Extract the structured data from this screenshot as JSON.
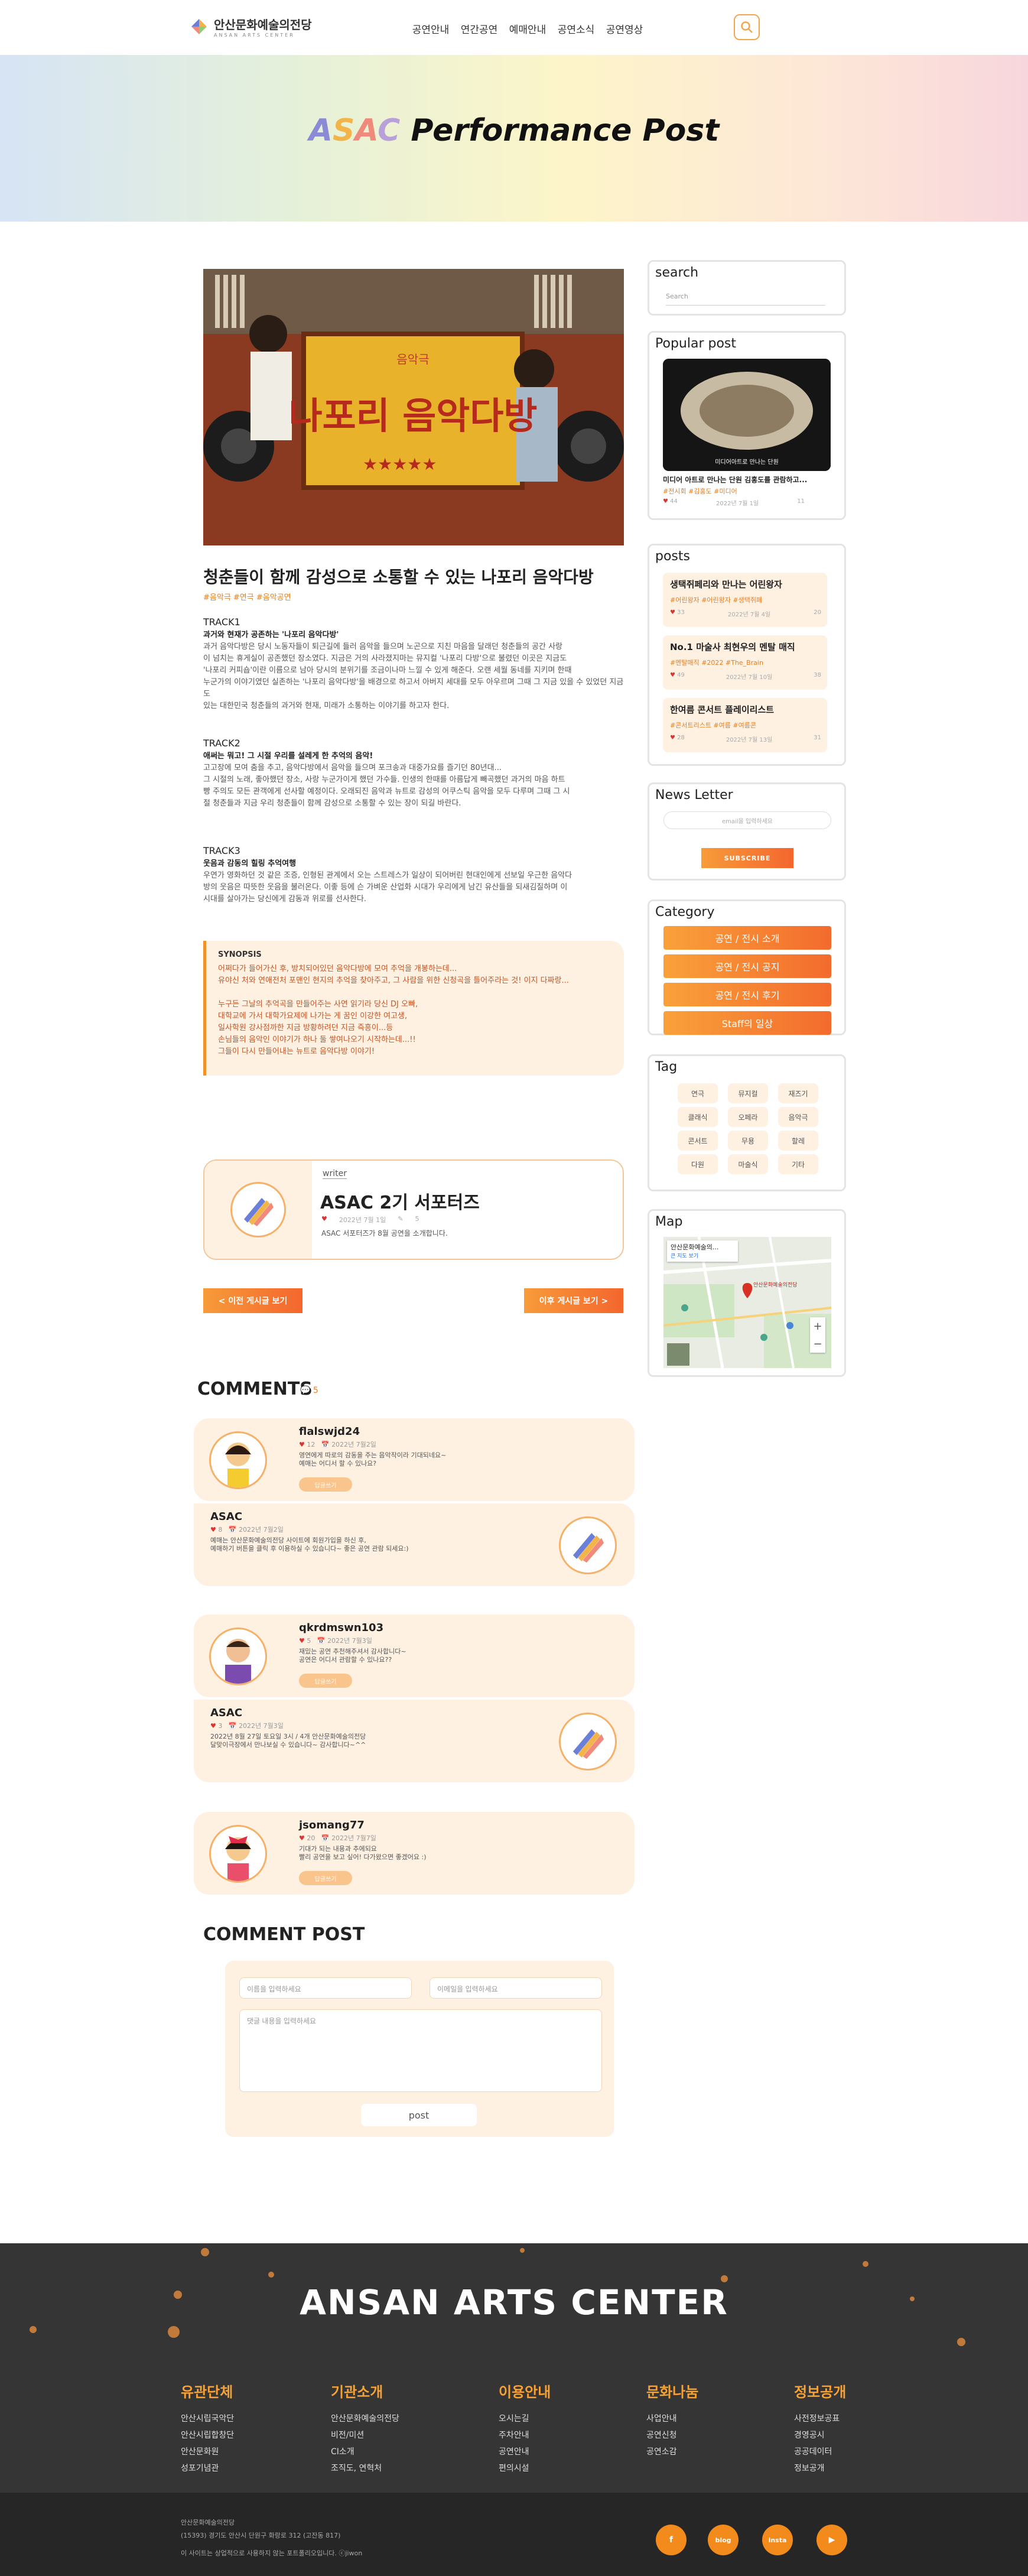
{
  "header": {
    "logo_text": "안산문화예술의전당",
    "logo_sub": "ANSAN ARTS CENTER",
    "nav": [
      "공연안내",
      "연간공연",
      "예매안내",
      "공연소식",
      "공연영상"
    ]
  },
  "hero": {
    "title_parts": [
      "A",
      "S",
      "A",
      "C",
      " Performance Post"
    ]
  },
  "post": {
    "image_title_small": "음악극",
    "image_title": "나포리 음악다방",
    "title": "청춘들이 함께 감성으로 소통할 수 있는 나포리 음악다방",
    "tags": "#음악극 #연극 #음악공연",
    "tracks": [
      {
        "label": "TRACK1",
        "subtitle": "과거와 현재가 공존하는 '나포리 음악다방'",
        "lines": [
          "과거 음악다방은 당시 노동자들이 퇴근길에 들러 음악을 들으며 노곤으로 지친 마음을 달래던 청춘들의 공간 사랑",
          "이 넘치는 휴게실이 공존했던 장소였다. 지금은 거의 사라졌지마는 뮤지컬 '나포리 다방'으로 불렸던 이곳은 지금도",
          "'나포리 커피숍'이란 이름으로 남아 당시의 분위기를 조금이나마 느낄 수 있게 해준다. 오랜 세월 동네를 지키며 한때",
          "누군가의 이야기였던 실존하는 '나포리 음악다방'을 배경으로 하고서 아버지 세대를 모두 아우르며 그때 그 지금 있을 수 있었던 지금도",
          "있는 대한민국 청춘들의 과거와 현재, 미래가 소통하는 이야기를 하고자 한다."
        ]
      },
      {
        "label": "TRACK2",
        "subtitle": "애써는 뭐고! 그 시절 우리를 설레게 한 추억의 음악!",
        "lines": [
          "고고장에 모여 춤을 추고, 음악다방에서 음악을 들으며 포크송과 대중가요를 즐기던 80년대...",
          "그 시절의 노래, 좋아했던 장소, 사랑 누군가이게 했던 가수들. 인생의 한때를 아름답게 빼곡했던 과거의 마음 하트",
          "빵 주의도 모든 관객에게 선사할 예정이다. 오래되진 음악과 뉴트로 감성의 어쿠스틱 음악을 모두 다루며 그때 그 시",
          "절 청춘들과 지금 우리 청춘들이 함께 감성으로 소통할 수 있는 장이 되길 바란다."
        ]
      },
      {
        "label": "TRACK3",
        "subtitle": "웃음과 감동의 힐링 추억여행",
        "lines": [
          "우연가 영화하던 것 같은 조증, 인형된 관계에서 오는 스트레스가 일상이 되어버린 현대인에게 선보일 우근한 음악다",
          "방의 웃음은 따뜻한 웃음을 불러온다. 이좋 등에 슨 가벼운 산업화 시대가 우리에게 남긴 유산들을 되새김질하며 이",
          "시대를 살아가는 당신에게 감동과 위로를 선사한다."
        ]
      }
    ],
    "synopsis_title": "SYNOPSIS",
    "synopsis_lines": [
      "어쩌다가 들어가신 후, 방치되어있던 음악다방에 모여 추억을 개봉하는데...",
      "유야신 처와 연애전처 포맨인 현지의 추억을 찾아주고, 그 사람을 위한 신청곡을 틀어주라는 것! 이지 다짜랑...",
      "",
      "누구든 그날의 추억곡을 만들어주는 사연 읽기라 당신 DJ 오빠,",
      "대학교에 가서 대학가요제에 나가는 게 꿈인 이강한 여고생,",
      "일사학원 강사점까한 지금 방황하려던 지금 즉흥이...등",
      "손님들의 음악인 이야기가 하나 둘 쌓여나오기 시작하는데...!!",
      "그들이 다시 만들어내는 뉴트로 음악다방 이야기!"
    ]
  },
  "writer": {
    "label": "writer",
    "name": "ASAC 2기 서포터즈",
    "likes": "",
    "date": "2022년 7월 1일",
    "comments": "5",
    "desc": "ASAC 서포터즈가 8월 공연을 소개합니다."
  },
  "pager": {
    "prev": "< 이전 게시글 보기",
    "next": "이후 게시글 보기 >"
  },
  "comments_section": {
    "title": "COMMENTS",
    "count": "5",
    "items": [
      {
        "name": "flalswjd24",
        "likes": "12",
        "date": "2022년 7월2일",
        "lines": [
          "영연에게 따로의 감동을 주는 음악작이라 기대되네요~",
          "예매는 어디서 할 수 있나요?"
        ],
        "reply": "답글쓰기"
      },
      {
        "name": "ASAC",
        "likes": "8",
        "date": "2022년 7월2일",
        "lines": [
          "예매는 안산문화예술의전당 사이트에 회원가입을 하신 후,",
          "예매하기 버튼을 클릭 후 이용하실 수 있습니다~ 좋은 공연 관람 되세요:)"
        ]
      },
      {
        "name": "qkrdmswn103",
        "likes": "5",
        "date": "2022년 7월3일",
        "lines": [
          "재밌는 공연 추천해주셔서 감사합니다~",
          "공연은 어디서 관람할 수 있나요??"
        ],
        "reply": "답글쓰기"
      },
      {
        "name": "ASAC",
        "likes": "3",
        "date": "2022년 7월3일",
        "lines": [
          "2022년 8월 27일 토요일 3시 / 4개 안산문화예술의전당",
          "달맞이극장에서 만나보실 수 있습니다~ 감사합니다~^^"
        ]
      },
      {
        "name": "jsomang77",
        "likes": "20",
        "date": "2022년 7월7일",
        "lines": [
          "기대가 되는 내용과 추에되요",
          "빨리 공연을 보고 싶어! 다가왔으면 좋겠어요 :)"
        ],
        "reply": "답글쓰기"
      }
    ]
  },
  "comment_post": {
    "title": "COMMENT POST",
    "name_placeholder": "이름을 입력하세요",
    "pw_placeholder": "이메일을 입력하세요",
    "body_placeholder": "댓글 내용을 입력하세요",
    "submit": "post"
  },
  "sidebar": {
    "search": {
      "title": "search",
      "placeholder": "Search"
    },
    "popular": {
      "title": "Popular post",
      "caption": "미디어 아트로 만나는 단원 김홍도를 관람하고...",
      "tags": "#전시회 #김홍도 #미디어",
      "likes": "44",
      "date": "2022년 7월 1일",
      "comments": "11"
    },
    "posts": {
      "title": "posts",
      "items": [
        {
          "title": "생택쥐페리와 만나는 어린왕자",
          "tags": "#어린왕자  #어린왕자  #생택쥐페",
          "likes": "33",
          "date": "2022년 7월 4일",
          "comments": "20"
        },
        {
          "title": "No.1 마술사 최현우의 멘탈 매직",
          "tags": "#멘탈매직  #2022  #The_Brain",
          "likes": "49",
          "date": "2022년 7월 10일",
          "comments": "38"
        },
        {
          "title": "한여름 콘서트 플레이리스트",
          "tags": "#콘서트리스트  #여름  #여름콘",
          "likes": "28",
          "date": "2022년 7월 13일",
          "comments": "31"
        }
      ]
    },
    "newsletter": {
      "title": "News Letter",
      "placeholder": "email을 입력하세요",
      "button": "SUBSCRIBE"
    },
    "category": {
      "title": "Category",
      "items": [
        "공연 / 전시 소개",
        "공연 / 전시 공지",
        "공연 / 전시 후기",
        "Staff의 일상"
      ]
    },
    "tags": {
      "title": "Tag",
      "items": [
        "연극",
        "뮤지컬",
        "재즈기",
        "클래식",
        "오페라",
        "음악극",
        "콘서트",
        "무용",
        "할레",
        "다원",
        "마술식",
        "기타"
      ]
    },
    "map": {
      "title": "Map",
      "place": "안산문화예술의...",
      "sub": "큰 지도 보기",
      "pin_label": "안산문화예술의전당",
      "zoom_in": "+",
      "zoom_out": "−"
    }
  },
  "footer": {
    "brand": "ANSAN ARTS CENTER",
    "columns": [
      {
        "head": "유관단체",
        "items": [
          "안산시립국악단",
          "안산시립합창단",
          "안산문화원",
          "성포기념관"
        ]
      },
      {
        "head": "기관소개",
        "items": [
          "안산문화예술의전당",
          "비전/미션",
          "CI소개",
          "조직도, 연혁처"
        ]
      },
      {
        "head": "이용안내",
        "items": [
          "오시는길",
          "주차안내",
          "공연안내",
          "편의시설"
        ]
      },
      {
        "head": "문화나눔",
        "items": [
          "사업안내",
          "공연신청",
          "공연소감"
        ]
      },
      {
        "head": "정보공개",
        "items": [
          "사전정보공표",
          "경영공시",
          "공공데이터",
          "정보공개"
        ]
      }
    ],
    "info": [
      "안산문화예술의전당",
      "(15393) 경기도 안산시 단원구 화랑로 312 (고잔동 817)",
      "이 사이트는 상업적으로 사용하지 않는 포트폴리오입니다. ⓒjiwon"
    ],
    "sns": [
      "f",
      "blog",
      "insta",
      "▶"
    ]
  },
  "colors": {
    "accent": "#f7942e",
    "accent_light": "#fef1e2",
    "footer_bg": "#353535"
  }
}
